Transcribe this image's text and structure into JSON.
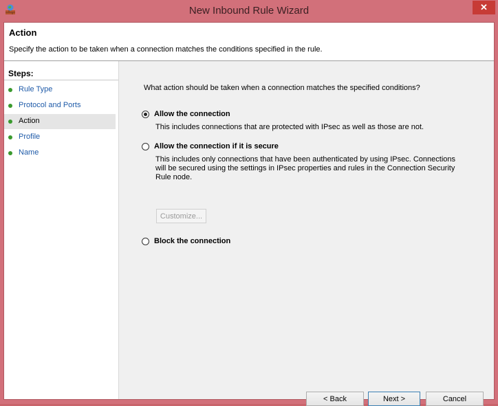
{
  "window": {
    "title": "New Inbound Rule Wizard",
    "close_glyph": "✕"
  },
  "header": {
    "title": "Action",
    "description": "Specify the action to be taken when a connection matches the conditions specified in the rule."
  },
  "steps": {
    "title": "Steps:",
    "items": [
      {
        "label": "Rule Type"
      },
      {
        "label": "Protocol and Ports"
      },
      {
        "label": "Action"
      },
      {
        "label": "Profile"
      },
      {
        "label": "Name"
      }
    ]
  },
  "main": {
    "question": "What action should be taken when a connection matches the specified conditions?",
    "options": [
      {
        "label": "Allow the connection",
        "description": "This includes connections that are protected with IPsec as well as those are not.",
        "selected": true
      },
      {
        "label": "Allow the connection if it is secure",
        "description_lines": [
          "This includes only connections that have been authenticated by using IPsec.  Connections",
          "will be secured using the settings in IPsec properties and rules in the Connection Security",
          "Rule node."
        ],
        "selected": false
      },
      {
        "label": "Block the connection",
        "selected": false
      }
    ],
    "customize_label": "Customize..."
  },
  "footer": {
    "back_label": "< Back",
    "next_label": "Next >",
    "cancel_label": "Cancel"
  },
  "colors": {
    "frame": "#d2707a",
    "close": "#c73b36",
    "step_dot": "#3a9a2e",
    "step_link": "#1e5aa8"
  }
}
